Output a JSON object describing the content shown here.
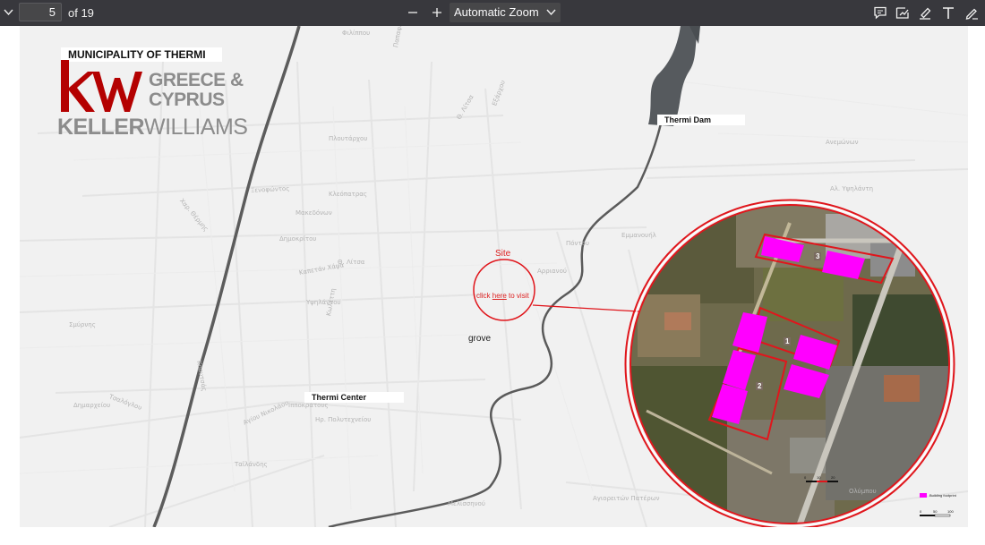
{
  "toolbar": {
    "sidebar_toggle_icon": "chevron-down-icon",
    "page_number": "5",
    "page_count": "of 19",
    "zoom_out_icon": "minus-icon",
    "zoom_in_icon": "plus-icon",
    "zoom_value": "Automatic Zoom",
    "tools": [
      "comment-icon",
      "signature-icon",
      "highlight-icon",
      "text-icon",
      "draw-icon"
    ]
  },
  "document": {
    "municipality_title": "MUNICIPALITY OF THERMI",
    "logo": {
      "mark": "kw",
      "region": [
        "GREECE &",
        "CYPRUS"
      ],
      "brand_part1": "KELLER",
      "brand_part2": "WILLIAMS",
      "brand_color": "#b40101",
      "gray_color": "#8c8c8c"
    },
    "labels": {
      "thermi_dam": "Thermi Dam",
      "thermi_center": "Thermi Center",
      "site": "Site",
      "click_prefix": "click ",
      "click_link": "here",
      "click_suffix": " to visit",
      "grove": "grove"
    },
    "plots": [
      "1",
      "2",
      "3"
    ],
    "legend": {
      "text": "Building footprint",
      "color": "#ff00ff"
    },
    "scale_marks": [
      "0",
      "10",
      "20"
    ],
    "scale_marks_2": [
      "0",
      "50",
      "100"
    ],
    "highlight_color": "#e0161c",
    "streets": [
      "Φιλίππου",
      "Παπαφλέσσα",
      "Θ. Λίτσα",
      "Εξάρχου",
      "Πλουτάρχου",
      "Κλεόπατρας",
      "Ξενοφώντος",
      "Μακεδόνων",
      "Δημοκρίτου",
      "Θ. Λίτσα",
      "Πόντου",
      "Αρριανού",
      "Εμμανουήλ",
      "Υψηλάντου",
      "Καπετάν Χάψα",
      "Κωλέττη",
      "Ιπποκράτους",
      "Αλ. Υψηλάντη",
      "Ηρ. Πολυτεχνείου",
      "Ταϊλάνδης",
      "Μελισσηνού",
      "Ολύμπου",
      "Αγιορειτών Πατέρων",
      "Αγίου Νικολάου",
      "Ανεμώνων",
      "Δημαρχείου",
      "Σμύρνης",
      "Τσαλόγλου",
      "Χαρ. Θέρμης",
      "Κορυτσάς"
    ]
  }
}
